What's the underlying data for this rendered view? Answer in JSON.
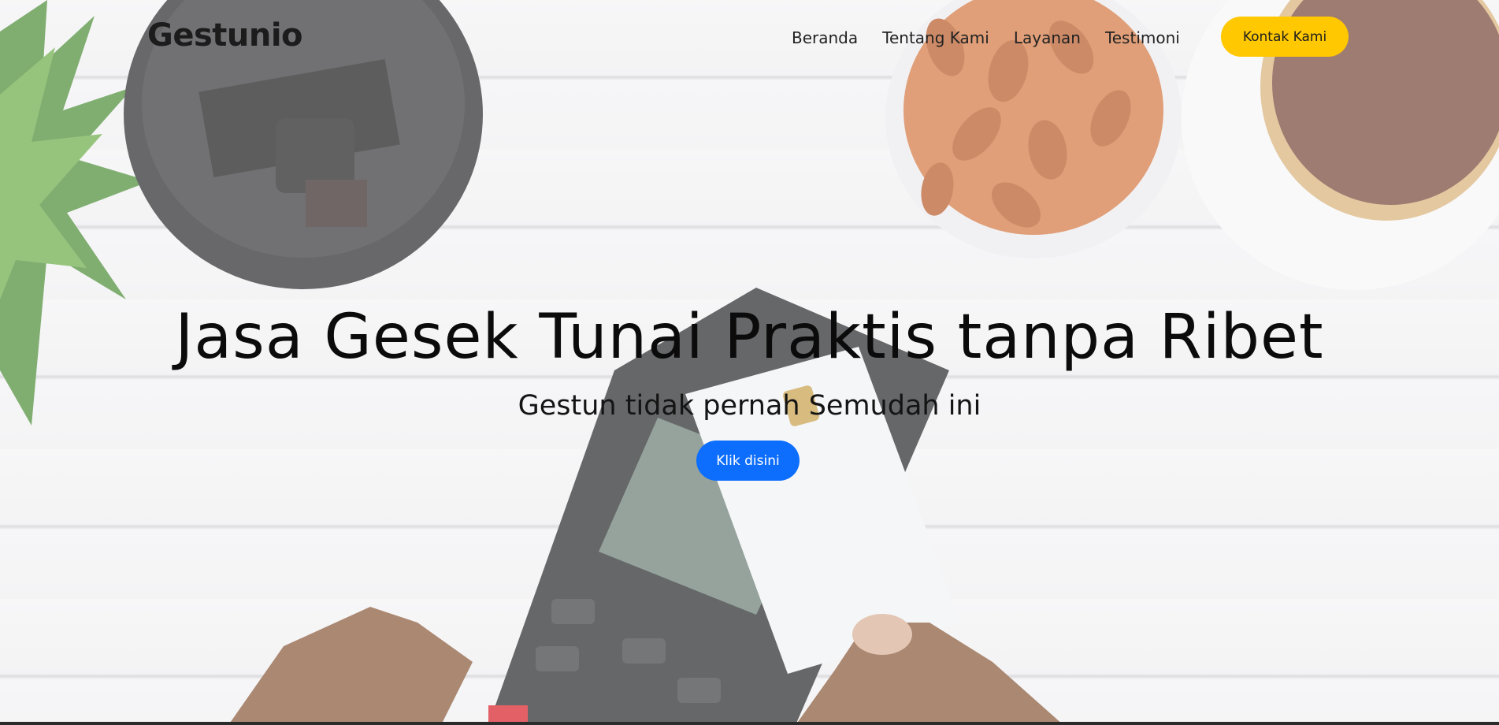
{
  "navbar": {
    "brand": "Gestunio",
    "links": [
      "Beranda",
      "Tentang Kami",
      "Layanan",
      "Testimoni"
    ],
    "cta_label": "Kontak Kami",
    "cta_color": "#ffc800"
  },
  "hero": {
    "title": "Jasa Gesek Tunai Praktis tanpa Ribet",
    "subtitle": "Gestun tidak pernah Semudah ini",
    "button_label": "Klik disini",
    "button_color": "#0d6efd",
    "background_icons": [
      "coffee-cup-lid-icon",
      "plant-icon",
      "almond-bowl-icon",
      "cookie-plate-icon",
      "card-terminal-icon",
      "credit-card-icon",
      "hand-icon"
    ]
  }
}
